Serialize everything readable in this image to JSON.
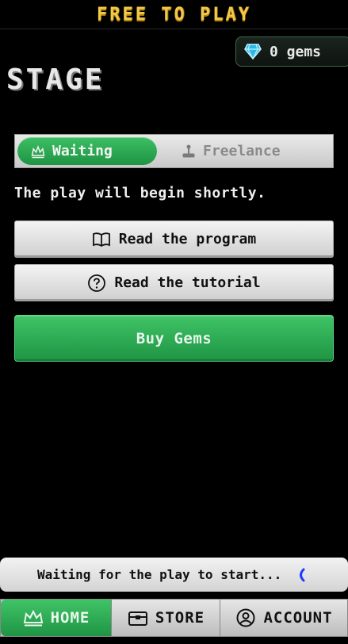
{
  "app_title": "FREE TO PLAY",
  "gems": {
    "label": "0 gems",
    "icon": "gem-icon"
  },
  "page_title": "STAGE",
  "mode_toggle": {
    "options": [
      {
        "label": "Waiting",
        "icon": "crown-icon",
        "selected": true
      },
      {
        "label": "Freelance",
        "icon": "joystick-icon",
        "selected": false
      }
    ]
  },
  "message": "The play will begin shortly.",
  "buttons": {
    "program": {
      "label": "Read the program",
      "icon": "book-icon"
    },
    "tutorial": {
      "label": "Read the tutorial",
      "icon": "question-icon"
    },
    "buy": {
      "label": "Buy Gems"
    }
  },
  "status": {
    "text": "Waiting for the play to start...",
    "icon": "spinner-icon"
  },
  "nav": {
    "items": [
      {
        "label": "HOME",
        "icon": "crown-icon",
        "active": true
      },
      {
        "label": "STORE",
        "icon": "chest-icon",
        "active": false
      },
      {
        "label": "ACCOUNT",
        "icon": "user-icon",
        "active": false
      }
    ]
  },
  "colors": {
    "accent_green": "#2fae55",
    "title_gold": "#f2c94c",
    "spinner_blue": "#1e3cff"
  }
}
